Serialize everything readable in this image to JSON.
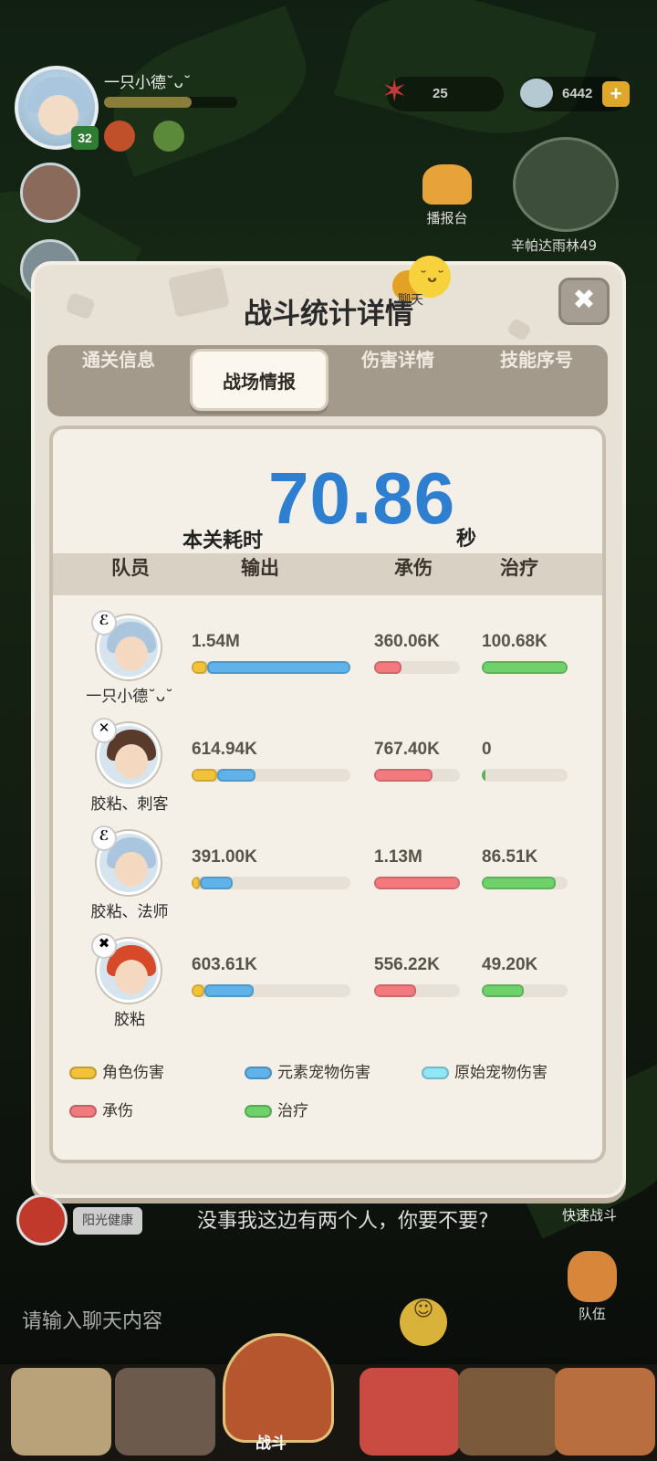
{
  "hud": {
    "player_name": "一只小德˘ᴗ˘",
    "level": "32",
    "resource1": "25",
    "resource2": "6442",
    "plus_label": "+",
    "broadcast_label": "播报台",
    "map_label": "辛帕达雨林49"
  },
  "dialog": {
    "title": "战斗统计详情",
    "chat_label": "聊天",
    "close_label": "✖",
    "tabs": [
      {
        "label": "通关信息",
        "active": false
      },
      {
        "label": "战场情报",
        "active": true
      },
      {
        "label": "伤害详情",
        "active": false
      },
      {
        "label": "技能序号",
        "active": false
      }
    ],
    "time_label": "本关耗时",
    "time_value": "70.86",
    "time_unit": "秒",
    "columns": [
      "队员",
      "输出",
      "承伤",
      "治疗"
    ],
    "rows": [
      {
        "name": "一只小德˘ᴗ˘",
        "badge": "ℰ",
        "output": "1.54M",
        "output_role": 0.1,
        "output_elem": 0.9,
        "taken": "360.06K",
        "taken_pct": 0.32,
        "heal": "100.68K",
        "heal_pct": 1.0
      },
      {
        "name": "胶粘、刺客",
        "badge": "✕",
        "output": "614.94K",
        "output_role": 0.16,
        "output_elem": 0.24,
        "taken": "767.40K",
        "taken_pct": 0.68,
        "heal": "0",
        "heal_pct": 0
      },
      {
        "name": "胶粘、法师",
        "badge": "ℰ",
        "output": "391.00K",
        "output_role": 0.05,
        "output_elem": 0.21,
        "taken": "1.13M",
        "taken_pct": 1.0,
        "heal": "86.51K",
        "heal_pct": 0.86
      },
      {
        "name": "胶粘",
        "badge": "✖",
        "output": "603.61K",
        "output_role": 0.08,
        "output_elem": 0.31,
        "taken": "556.22K",
        "taken_pct": 0.49,
        "heal": "49.20K",
        "heal_pct": 0.49
      }
    ],
    "legend": [
      {
        "label": "角色伤害",
        "color": "#f2c33a"
      },
      {
        "label": "元素宠物伤害",
        "color": "#5fb3ea"
      },
      {
        "label": "原始宠物伤害",
        "color": "#8fe6f7"
      },
      {
        "label": "承伤",
        "color": "#f27a7f"
      },
      {
        "label": "治疗",
        "color": "#6fd16a"
      }
    ]
  },
  "chat": {
    "tag": "阳光健康",
    "message": "没事我这边有两个人，你要不要?",
    "input_placeholder": "请输入聊天内容",
    "emoji_label": "☺"
  },
  "side": {
    "quick_fight": "快速战斗",
    "team": "队伍"
  },
  "nav": {
    "center_label": "战斗"
  },
  "colors": {
    "accent_blue": "#2f7fd1",
    "role": "#f2c33a",
    "elem": "#5fb3ea",
    "taken": "#f27a7f",
    "heal": "#6fd16a"
  }
}
